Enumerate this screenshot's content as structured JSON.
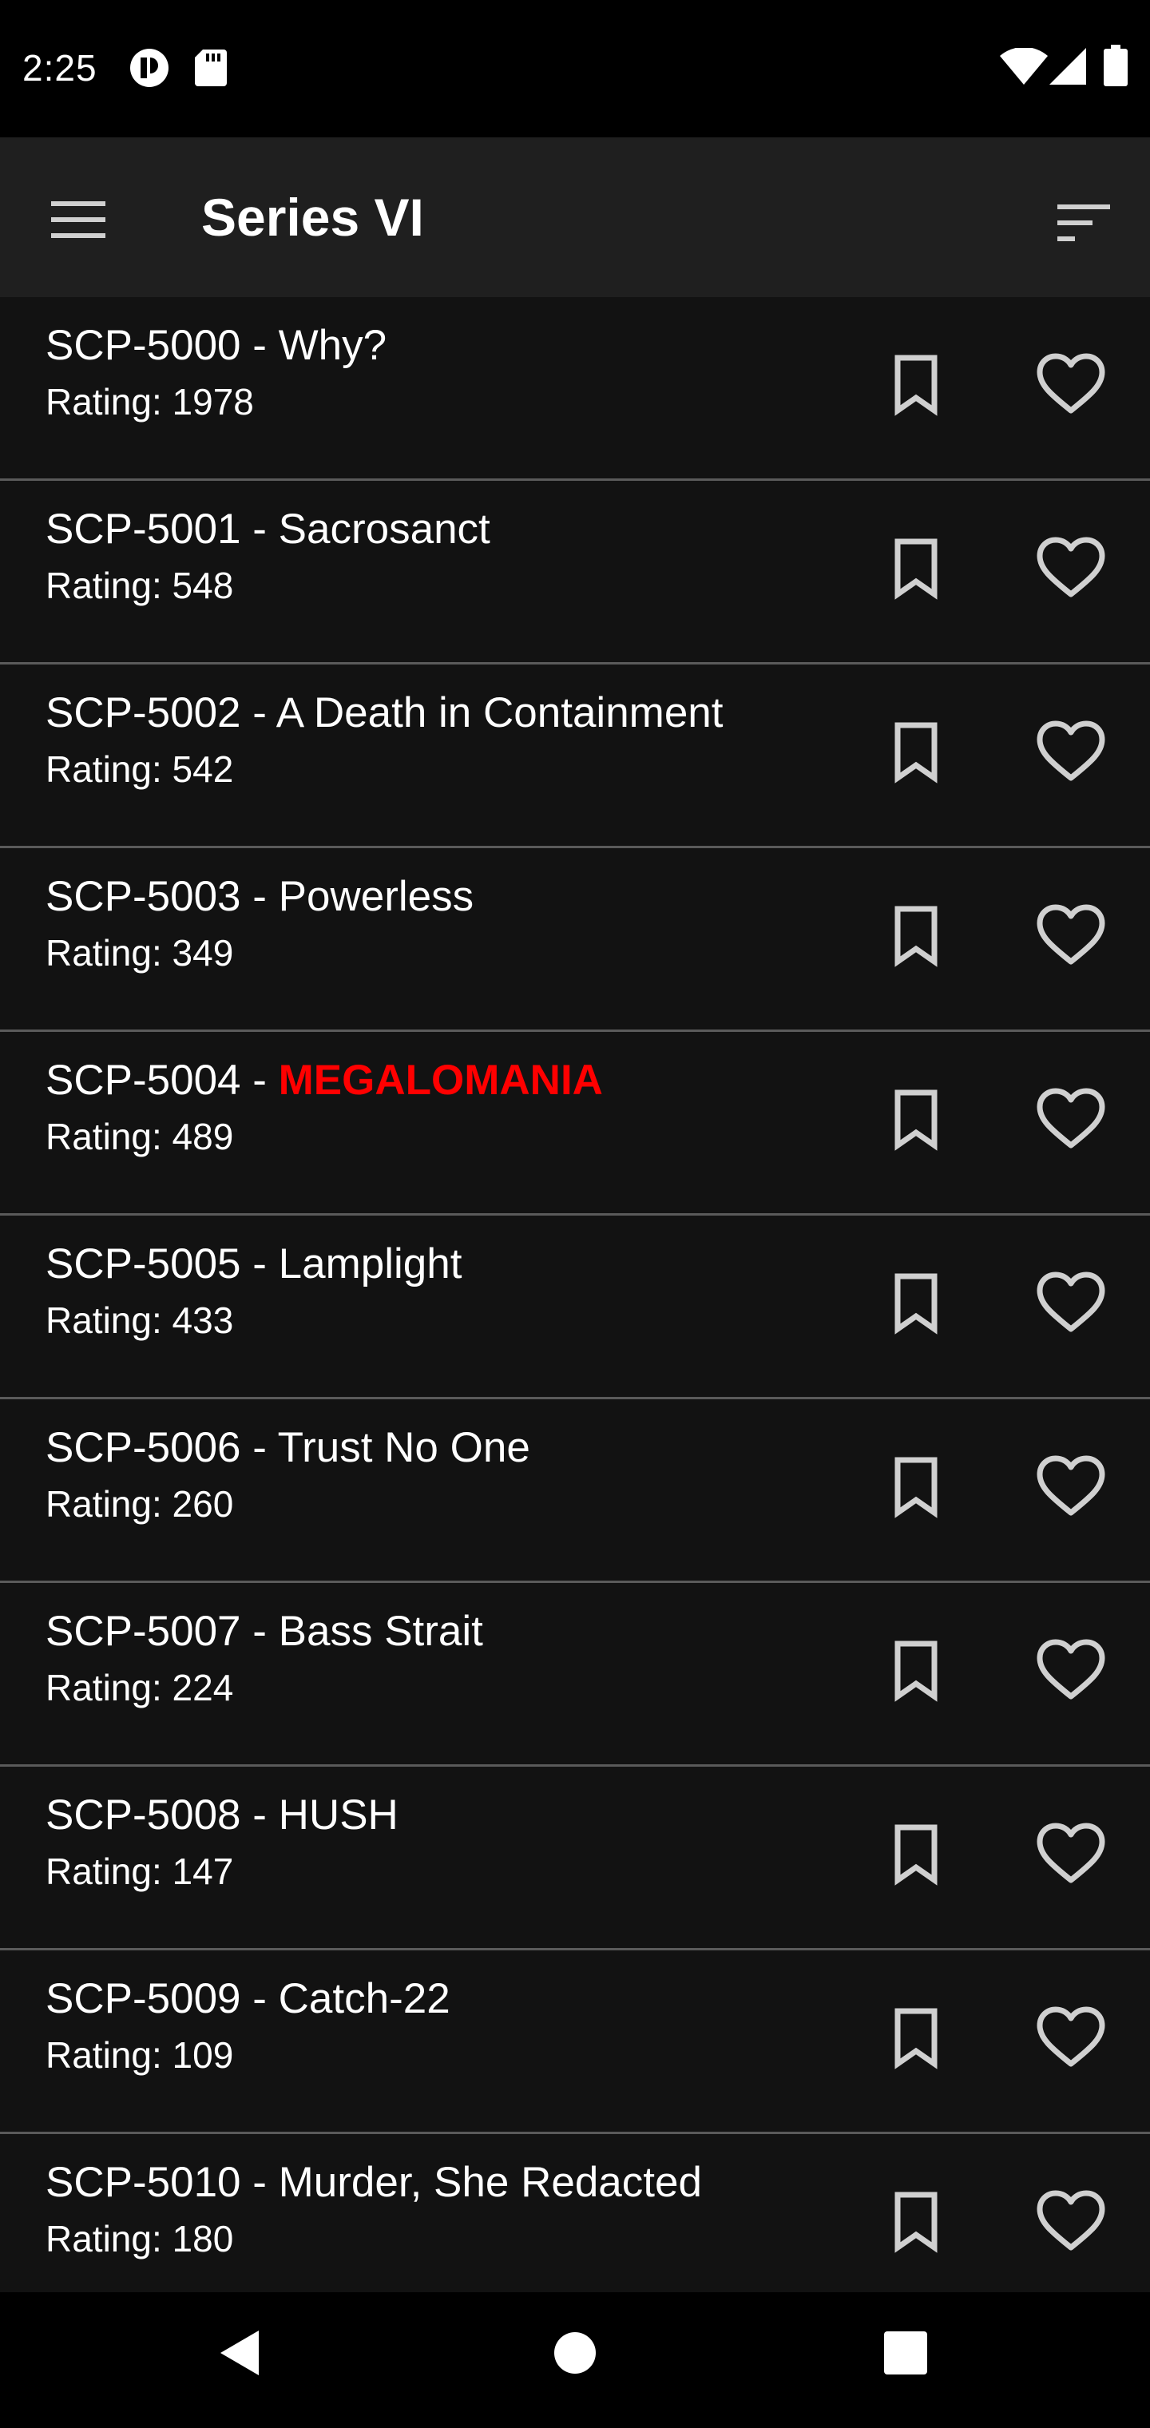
{
  "status_bar": {
    "time": "2:25",
    "icons": [
      "media-icon",
      "sd-card-icon",
      "wifi-icon",
      "signal-icon",
      "battery-icon"
    ]
  },
  "app_bar": {
    "title": "Series VI",
    "menu_icon": "hamburger-menu-icon",
    "sort_icon": "sort-icon"
  },
  "colors": {
    "background": "#121212",
    "app_bar": "#1f1f1f",
    "divider": "#5a5a5a",
    "highlight": "#ff0000",
    "icon": "#d0d0d0"
  },
  "items": [
    {
      "prefix": "SCP-5000 - ",
      "name": "Why?",
      "highlight": false,
      "rating": "Rating: 1978"
    },
    {
      "prefix": "SCP-5001 - ",
      "name": "Sacrosanct",
      "highlight": false,
      "rating": "Rating: 548"
    },
    {
      "prefix": "SCP-5002 - ",
      "name": "A Death in Containment",
      "highlight": false,
      "rating": "Rating: 542"
    },
    {
      "prefix": "SCP-5003 - ",
      "name": "Powerless",
      "highlight": false,
      "rating": "Rating: 349"
    },
    {
      "prefix": "SCP-5004 - ",
      "name": "MEGALOMANIA",
      "highlight": true,
      "rating": "Rating: 489"
    },
    {
      "prefix": "SCP-5005 - ",
      "name": "Lamplight",
      "highlight": false,
      "rating": "Rating: 433"
    },
    {
      "prefix": "SCP-5006 - ",
      "name": "Trust No One",
      "highlight": false,
      "rating": "Rating: 260"
    },
    {
      "prefix": "SCP-5007 - ",
      "name": "Bass Strait",
      "highlight": false,
      "rating": "Rating: 224"
    },
    {
      "prefix": "SCP-5008 - ",
      "name": "HUSH",
      "highlight": false,
      "rating": "Rating: 147"
    },
    {
      "prefix": "SCP-5009 - ",
      "name": "Catch-22",
      "highlight": false,
      "rating": "Rating: 109"
    },
    {
      "prefix": "SCP-5010 - ",
      "name": "Murder, She Redacted",
      "highlight": false,
      "rating": "Rating: 180"
    }
  ],
  "item_icons": [
    "bookmark-outline-icon",
    "heart-outline-icon"
  ],
  "nav_bar": {
    "icons": [
      "back-triangle-icon",
      "home-circle-icon",
      "recents-square-icon"
    ]
  }
}
